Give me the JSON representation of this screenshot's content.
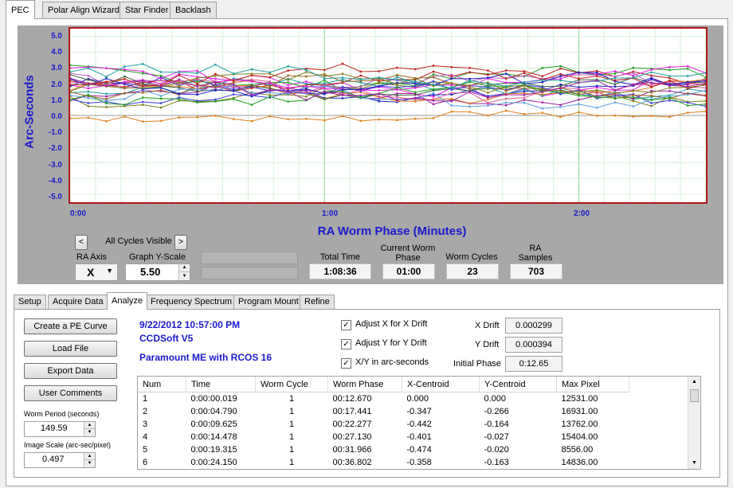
{
  "tabs": [
    "PEC",
    "Polar Align Wizard",
    "Star Finder",
    "Backlash"
  ],
  "graph": {
    "y_axis_label": "Arc-Seconds",
    "x_axis_title": "RA Worm Phase (Minutes)",
    "y_ticks": [
      "5.0",
      "4.0",
      "3.0",
      "2.0",
      "1.0",
      "0.0",
      "-1.0",
      "-2.0",
      "-3.0",
      "-4.0",
      "-5.0"
    ],
    "x_ticks": [
      "0:00",
      "1:00",
      "2:00"
    ]
  },
  "cycles": {
    "prev": "<",
    "label": "All Cycles Visible",
    "next": ">"
  },
  "controls": {
    "ra_axis_label": "RA Axis",
    "ra_axis_value": "X",
    "y_scale_label": "Graph Y-Scale",
    "y_scale_value": "5.50"
  },
  "stats": {
    "total_time_label": "Total Time",
    "total_time": "1:08:36",
    "worm_phase_label": "Current Worm Phase",
    "worm_phase": "01:00",
    "worm_cycles_label": "Worm Cycles",
    "worm_cycles": "23",
    "ra_samples_label": "RA Samples",
    "ra_samples": "703"
  },
  "subtabs": [
    "Setup",
    "Acquire Data",
    "Analyze",
    "Frequency Spectrum",
    "Program Mount",
    "Refine"
  ],
  "buttons": {
    "create": "Create a PE Curve",
    "load": "Load File",
    "export": "Export Data",
    "comments": "User Comments"
  },
  "left_fields": {
    "worm_period_label": "Worm Period (seconds)",
    "worm_period": "149.59",
    "image_scale_label": "Image Scale (arc-sec/pixel)",
    "image_scale": "0.497"
  },
  "info": {
    "datetime": "9/22/2012 10:57:00 PM",
    "software": "CCDSoft V5",
    "mount": "Paramount ME with RCOS 16"
  },
  "checks": {
    "adjust_x": "Adjust X for X Drift",
    "adjust_y": "Adjust Y for Y Drift",
    "xy_arcsec": "X/Y in arc-seconds"
  },
  "drift": {
    "x_label": "X Drift",
    "x_value": "0.000299",
    "y_label": "Y Drift",
    "y_value": "0.000394",
    "phase_label": "Initial Phase",
    "phase_value": "0:12.65"
  },
  "table": {
    "headers": [
      "Num",
      "Time",
      "Worm Cycle",
      "Worm Phase",
      "X-Centroid",
      "Y-Centroid",
      "Max Pixel"
    ],
    "rows": [
      [
        "1",
        "0:00:00.019",
        "1",
        "00:12.670",
        "0.000",
        "0.000",
        "12531.00"
      ],
      [
        "2",
        "0:00:04.790",
        "1",
        "00:17.441",
        "-0.347",
        "-0.266",
        "16931.00"
      ],
      [
        "3",
        "0:00:09.625",
        "1",
        "00:22.277",
        "-0.442",
        "-0.164",
        "13762.00"
      ],
      [
        "4",
        "0:00:14.478",
        "1",
        "00:27.130",
        "-0.401",
        "-0.027",
        "15404.00"
      ],
      [
        "5",
        "0:00:19.315",
        "1",
        "00:31.966",
        "-0.474",
        "-0.020",
        "8556.00"
      ],
      [
        "6",
        "0:00:24.150",
        "1",
        "00:36.802",
        "-0.358",
        "-0.163",
        "14836.00"
      ]
    ]
  },
  "colors": {
    "axis_blue": "#1a1acc",
    "plot_border": "#b01818",
    "grid": "#b8e6b8"
  },
  "icons": [
    "chevron-left-icon",
    "chevron-right-icon",
    "dropdown-arrow-icon",
    "spin-up-icon",
    "spin-down-icon",
    "scroll-up-icon",
    "scroll-down-icon"
  ]
}
